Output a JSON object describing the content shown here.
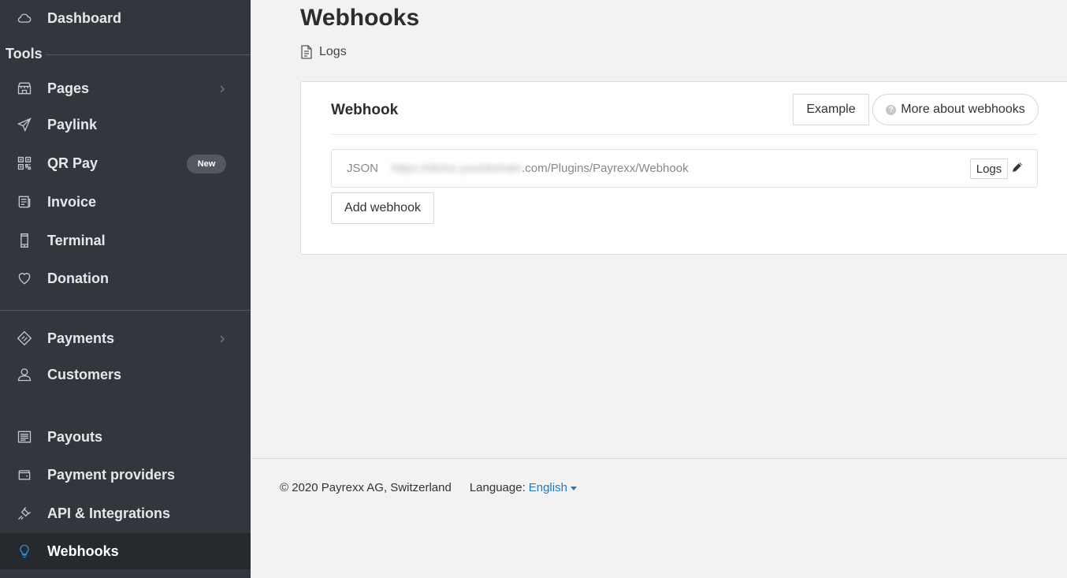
{
  "sidebar": {
    "dashboard": "Dashboard",
    "tools_heading": "Tools",
    "items": [
      {
        "label": "Pages"
      },
      {
        "label": "Paylink"
      },
      {
        "label": "QR Pay",
        "badge": "New"
      },
      {
        "label": "Invoice"
      },
      {
        "label": "Terminal"
      },
      {
        "label": "Donation"
      },
      {
        "label": "Payments"
      },
      {
        "label": "Customers"
      },
      {
        "label": "Payouts"
      },
      {
        "label": "Payment providers"
      },
      {
        "label": "API & Integrations"
      },
      {
        "label": "Webhooks"
      }
    ],
    "active_color": "#2f8fdc"
  },
  "main": {
    "title": "Webhooks",
    "logs_link": "Logs",
    "card": {
      "title": "Webhook",
      "example_button": "Example",
      "more_button": "More about webhooks",
      "webhook": {
        "type": "JSON",
        "url_hidden": "https://demo.yourdomain",
        "url_visible": ".com/Plugins/Payrexx/Webhook",
        "logs_button": "Logs"
      },
      "add_button": "Add webhook"
    }
  },
  "footer": {
    "copyright": "© 2020 Payrexx AG, Switzerland",
    "language_label": "Language:",
    "language_value": "English"
  }
}
